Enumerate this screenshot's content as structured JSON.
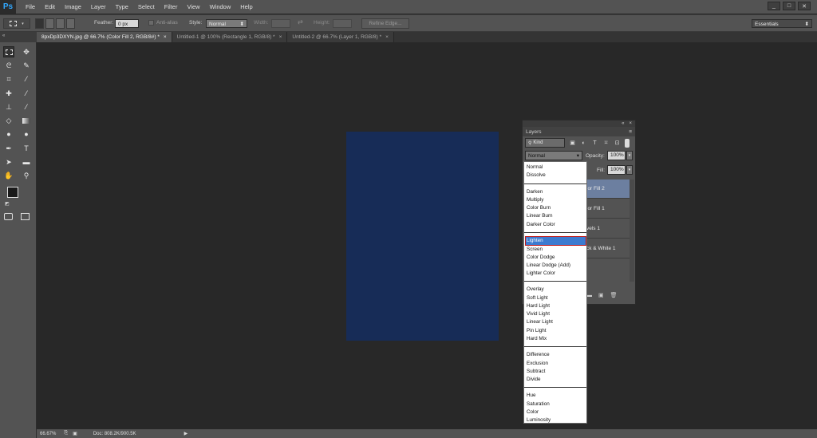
{
  "app": {
    "logo": "Ps"
  },
  "menu": [
    "File",
    "Edit",
    "Image",
    "Layer",
    "Type",
    "Select",
    "Filter",
    "View",
    "Window",
    "Help"
  ],
  "window_controls": [
    "_",
    "□",
    "✕"
  ],
  "options_bar": {
    "feather_label": "Feather:",
    "feather_value": "0 px",
    "anti_alias_label": "Anti-alias",
    "style_label": "Style:",
    "style_value": "Normal",
    "width_label": "Width:",
    "height_label": "Height:",
    "refine_edge_label": "Refine Edge...",
    "workspace_value": "Essentials"
  },
  "tabs": [
    {
      "label": "8pxDp3DXYN.jpg @ 66.7% (Color Fill 2, RGB/8#) *",
      "close": "×"
    },
    {
      "label": "Untitled-1 @ 100% (Rectangle 1, RGB/8) *",
      "close": "×"
    },
    {
      "label": "Untitled-2 @ 66.7% (Layer 1, RGB/8) *",
      "close": "×"
    }
  ],
  "status_bar": {
    "zoom": "66.67%",
    "doc_info": "Doc: 808.2K/900.5K"
  },
  "canvas": {
    "document_color": "#172c57"
  },
  "layers_panel": {
    "title": "Layers",
    "kind_label": "Kind",
    "blend_mode": "Normal",
    "opacity_label": "Opacity:",
    "opacity_value": "100%",
    "fill_label": "Fill:",
    "fill_value": "100%",
    "layers": [
      "lor Fill 2",
      "lor Fill 1",
      "vels 1",
      "ck & White 1"
    ]
  },
  "blend_dropdown": {
    "groups": [
      [
        "Normal",
        "Dissolve"
      ],
      [
        "Darken",
        "Multiply",
        "Color Burn",
        "Linear Burn",
        "Darker Color"
      ],
      [
        "Lighten",
        "Screen",
        "Color Dodge",
        "Linear Dodge (Add)",
        "Lighter Color"
      ],
      [
        "Overlay",
        "Soft Light",
        "Hard Light",
        "Vivid Light",
        "Linear Light",
        "Pin Light",
        "Hard Mix"
      ],
      [
        "Difference",
        "Exclusion",
        "Subtract",
        "Divide"
      ],
      [
        "Hue",
        "Saturation",
        "Color",
        "Luminosity"
      ]
    ],
    "highlighted": "Lighten"
  }
}
